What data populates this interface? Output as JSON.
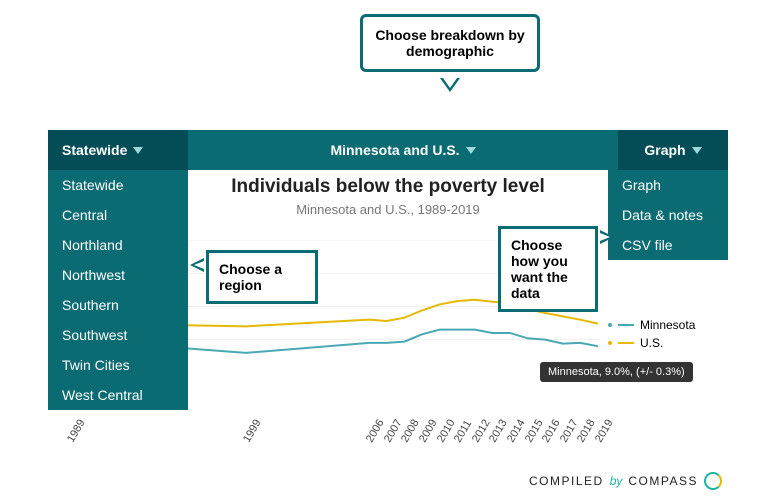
{
  "callouts": {
    "top": "Choose breakdown by demographic",
    "region": "Choose a region",
    "data": "Choose how you want the data"
  },
  "nav": {
    "statewide": "Statewide",
    "center": "Minnesota and U.S.",
    "graph": "Graph"
  },
  "dropdown_left": [
    "Statewide",
    "Central",
    "Northland",
    "Northwest",
    "Southern",
    "Southwest",
    "Twin Cities",
    "West Central"
  ],
  "dropdown_right": [
    "Graph",
    "Data & notes",
    "CSV file"
  ],
  "chart": {
    "title": "Individuals below the poverty level",
    "subtitle": "Minnesota and U.S., 1989-2019"
  },
  "legend": {
    "mn": "Minnesota",
    "us": "U.S."
  },
  "tooltip": "Minnesota, 9.0%, (+/- 0.3%)",
  "brand": {
    "compiled": "COMPILED",
    "by": "by",
    "name": "COMPASS"
  },
  "colors": {
    "teal": "#0a6b73",
    "line_mn": "#49a8b3",
    "line_us": "#e6b800",
    "grid": "#e0e0e0"
  },
  "chart_data": {
    "type": "line",
    "title": "Individuals below the poverty level",
    "subtitle": "Minnesota and U.S., 1989-2019",
    "xlabel": "",
    "ylabel": "",
    "x": [
      1989,
      1999,
      2006,
      2007,
      2008,
      2009,
      2010,
      2011,
      2012,
      2013,
      2014,
      2015,
      2016,
      2017,
      2018,
      2019
    ],
    "ylim": [
      0,
      25
    ],
    "yticks": [
      10,
      15,
      20,
      25
    ],
    "series": [
      {
        "name": "Minnesota",
        "color": "#49a8b3",
        "values": [
          10.0,
          8.0,
          9.5,
          9.5,
          9.7,
          10.8,
          11.5,
          11.5,
          11.5,
          11.0,
          11.0,
          10.2,
          10.0,
          9.4,
          9.5,
          9.0
        ]
      },
      {
        "name": "U.S.",
        "color": "#e6b800",
        "values": [
          12.5,
          12.0,
          13.0,
          12.8,
          13.3,
          14.4,
          15.3,
          15.8,
          16.0,
          15.7,
          15.5,
          14.6,
          14.0,
          13.5,
          13.0,
          12.4
        ]
      }
    ]
  }
}
